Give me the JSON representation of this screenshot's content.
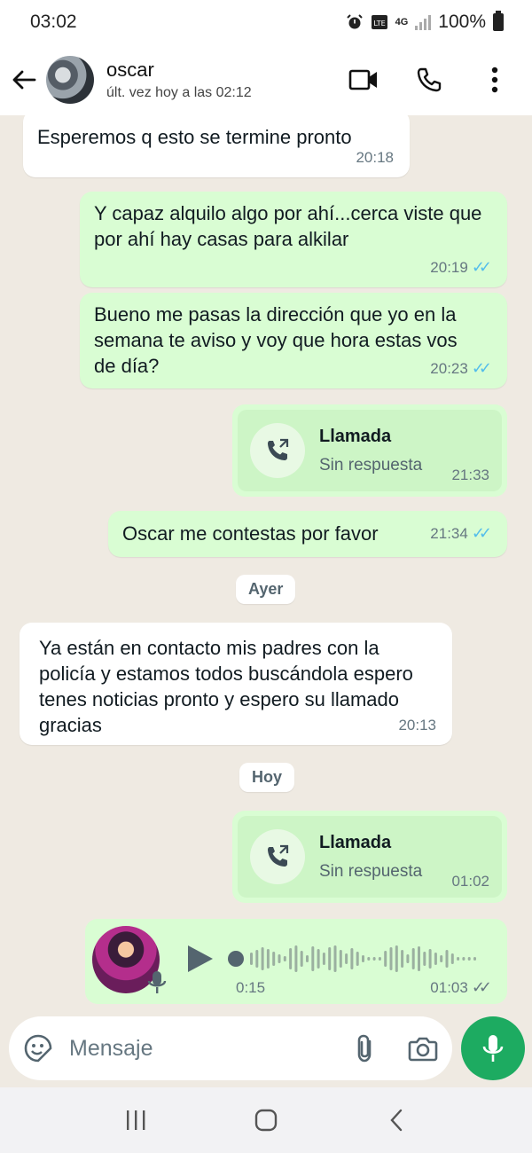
{
  "status_bar": {
    "time": "03:02",
    "network": "4G",
    "battery": "100%"
  },
  "header": {
    "contact_name": "oscar",
    "last_seen": "últ. vez hoy a las 02:12",
    "icons": [
      "back-arrow-icon",
      "video-call-icon",
      "phone-icon",
      "more-vert-icon"
    ]
  },
  "messages": [
    {
      "dir": "in",
      "text": "Esperemos q esto se termine pronto",
      "time": "20:18"
    },
    {
      "dir": "out",
      "text": "Y capaz alquilo algo por ahí...cerca viste que por ahí hay casas para alkilar",
      "time": "20:19",
      "read": true
    },
    {
      "dir": "out",
      "text": "Bueno me pasas la dirección que yo en la semana te aviso y voy que hora estas vos de día?",
      "time": "20:23",
      "read": true
    },
    {
      "dir": "out",
      "type": "call",
      "title": "Llamada",
      "subtitle": "Sin respuesta",
      "time": "21:33"
    },
    {
      "dir": "out",
      "text": "Oscar me contestas por favor",
      "time": "21:34",
      "read": true
    },
    {
      "type": "date",
      "label": "Ayer"
    },
    {
      "dir": "in",
      "text": "Ya están en contacto mis padres con la policía y estamos todos buscándola espero tenes noticias pronto y espero su llamado gracias",
      "time": "20:13"
    },
    {
      "type": "date",
      "label": "Hoy"
    },
    {
      "dir": "out",
      "type": "call",
      "title": "Llamada",
      "subtitle": "Sin respuesta",
      "time": "01:02"
    },
    {
      "dir": "out",
      "type": "voice",
      "duration": "0:15",
      "time": "01:03",
      "read": false
    }
  ],
  "input": {
    "placeholder": "Mensaje"
  },
  "colors": {
    "outgoing": "#d9fdd3",
    "incoming": "#ffffff",
    "accent": "#1dab61",
    "read_ticks": "#53bdeb",
    "background": "#efeae2"
  }
}
